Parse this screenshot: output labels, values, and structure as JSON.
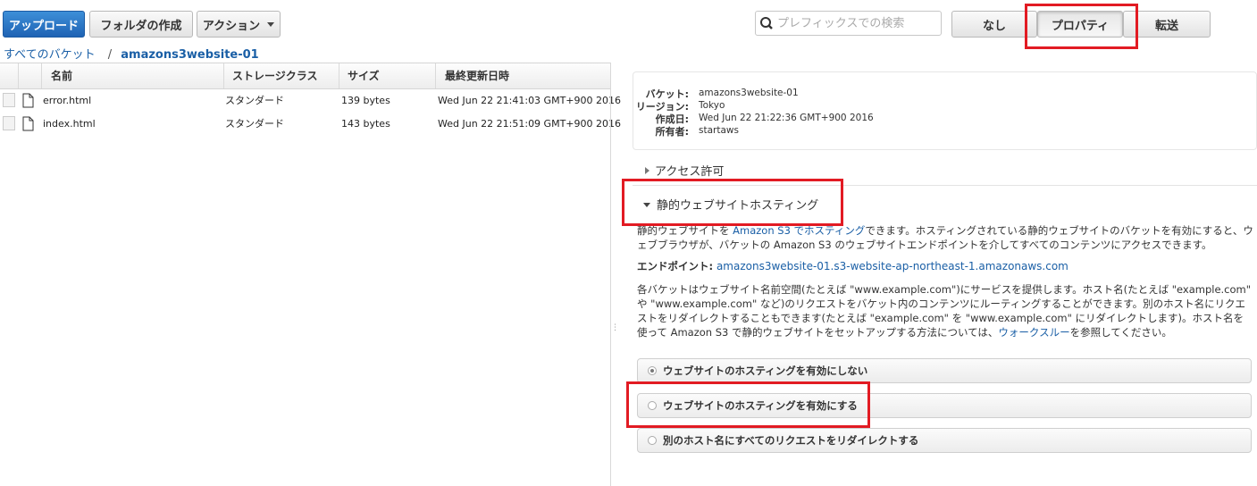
{
  "toolbar": {
    "upload_label": "アップロード",
    "create_folder_label": "フォルダの作成",
    "actions_label": "アクション",
    "search_placeholder": "プレフィックスでの検索",
    "view_none_label": "なし",
    "view_properties_label": "プロパティ",
    "view_transfer_label": "転送"
  },
  "breadcrumb": {
    "root": "すべてのバケット",
    "separator": "/",
    "current": "amazons3website-01"
  },
  "table": {
    "columns": [
      "名前",
      "ストレージクラス",
      "サイズ",
      "最終更新日時"
    ],
    "rows": [
      {
        "name": "error.html",
        "storage": "スタンダード",
        "size": "139 bytes",
        "modified": "Wed Jun 22 21:41:03 GMT+900 2016"
      },
      {
        "name": "index.html",
        "storage": "スタンダード",
        "size": "143 bytes",
        "modified": "Wed Jun 22 21:51:09 GMT+900 2016"
      }
    ]
  },
  "properties": {
    "bucket_label": "バケット:",
    "bucket_value": "amazons3website-01",
    "region_label": "リージョン:",
    "region_value": "Tokyo",
    "created_label": "作成日:",
    "created_value": "Wed Jun 22 21:22:36 GMT+900 2016",
    "owner_label": "所有者:",
    "owner_value": "startaws"
  },
  "sections": {
    "access": "アクセス許可",
    "hosting": "静的ウェブサイトホスティング"
  },
  "hosting": {
    "intro_a": "静的ウェブサイトを ",
    "intro_link": "Amazon S3 でホスティング",
    "intro_b": "できます。ホスティングされている静的ウェブサイトのバケットを有効にすると、ウェブブラウザが、バケットの Amazon S3 のウェブサイトエンドポイントを介してすべてのコンテンツにアクセスできます。",
    "endpoint_label": "エンドポイント:",
    "endpoint_value": "amazons3website-01.s3-website-ap-northeast-1.amazonaws.com",
    "desc_a": "各バケットはウェブサイト名前空間(たとえば \"www.example.com\")にサービスを提供します。ホスト名(たとえば \"example.com\" や \"www.example.com\" など)のリクエストをバケット内のコンテンツにルーティングすることができます。別のホスト名にリクエストをリダイレクトすることもできます(たとえば \"example.com\" を \"www.example.com\" にリダイレクトします)。ホスト名を使って Amazon S3 で静的ウェブサイトをセットアップする方法については、",
    "desc_link": "ウォークスルー",
    "desc_b": "を参照してください。",
    "option_disable": "ウェブサイトのホスティングを有効にしない",
    "option_enable": "ウェブサイトのホスティングを有効にする",
    "option_redirect": "別のホスト名にすべてのリクエストをリダイレクトする",
    "selected_option": "option_disable"
  },
  "colors": {
    "highlight_red": "#e21b23",
    "primary_blue": "#1f63b4",
    "link_blue": "#1a5fa6"
  }
}
